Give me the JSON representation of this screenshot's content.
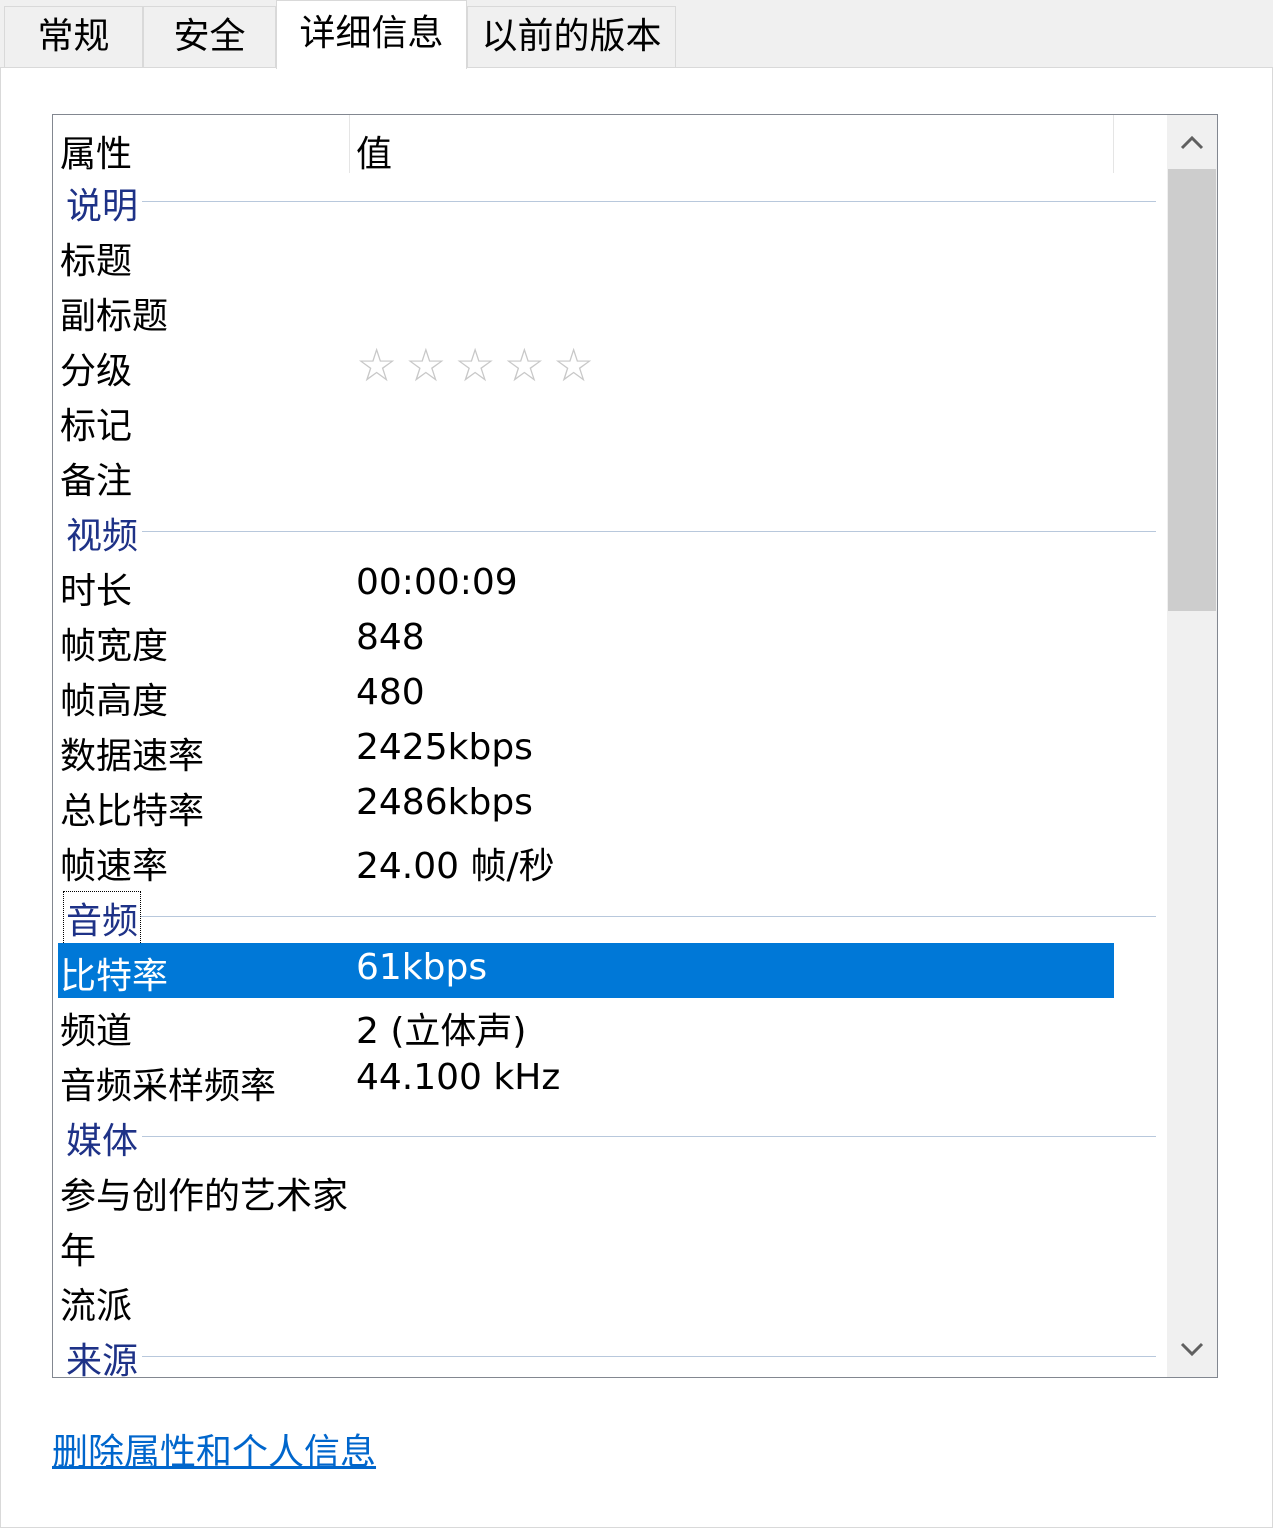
{
  "tabs": [
    {
      "label": "常规"
    },
    {
      "label": "安全"
    },
    {
      "label": "详细信息"
    },
    {
      "label": "以前的版本"
    }
  ],
  "header": {
    "property": "属性",
    "value": "值"
  },
  "groups": {
    "description": {
      "label": "说明",
      "rows": [
        {
          "key": "标题",
          "value": ""
        },
        {
          "key": "副标题",
          "value": ""
        },
        {
          "key": "分级",
          "rating": "0 of 5 stars"
        },
        {
          "key": "标记",
          "value": ""
        },
        {
          "key": "备注",
          "value": ""
        }
      ]
    },
    "video": {
      "label": "视频",
      "rows": [
        {
          "key": "时长",
          "value": "00:00:09"
        },
        {
          "key": "帧宽度",
          "value": "848"
        },
        {
          "key": "帧高度",
          "value": "480"
        },
        {
          "key": "数据速率",
          "value": "2425kbps"
        },
        {
          "key": "总比特率",
          "value": "2486kbps"
        },
        {
          "key": "帧速率",
          "value": "24.00 帧/秒"
        }
      ]
    },
    "audio": {
      "label": "音频",
      "rows": [
        {
          "key": "比特率",
          "value": "61kbps"
        },
        {
          "key": "频道",
          "value": "2 (立体声)"
        },
        {
          "key": "音频采样频率",
          "value": "44.100 kHz"
        }
      ]
    },
    "media": {
      "label": "媒体",
      "rows": [
        {
          "key": "参与创作的艺术家",
          "value": ""
        },
        {
          "key": "年",
          "value": ""
        },
        {
          "key": "流派",
          "value": ""
        }
      ]
    },
    "origin": {
      "label": "来源"
    }
  },
  "link": {
    "label": "删除属性和个人信息"
  },
  "colors": {
    "selection": "#0078d7",
    "group_label": "#1e3287",
    "link": "#0066cc"
  }
}
